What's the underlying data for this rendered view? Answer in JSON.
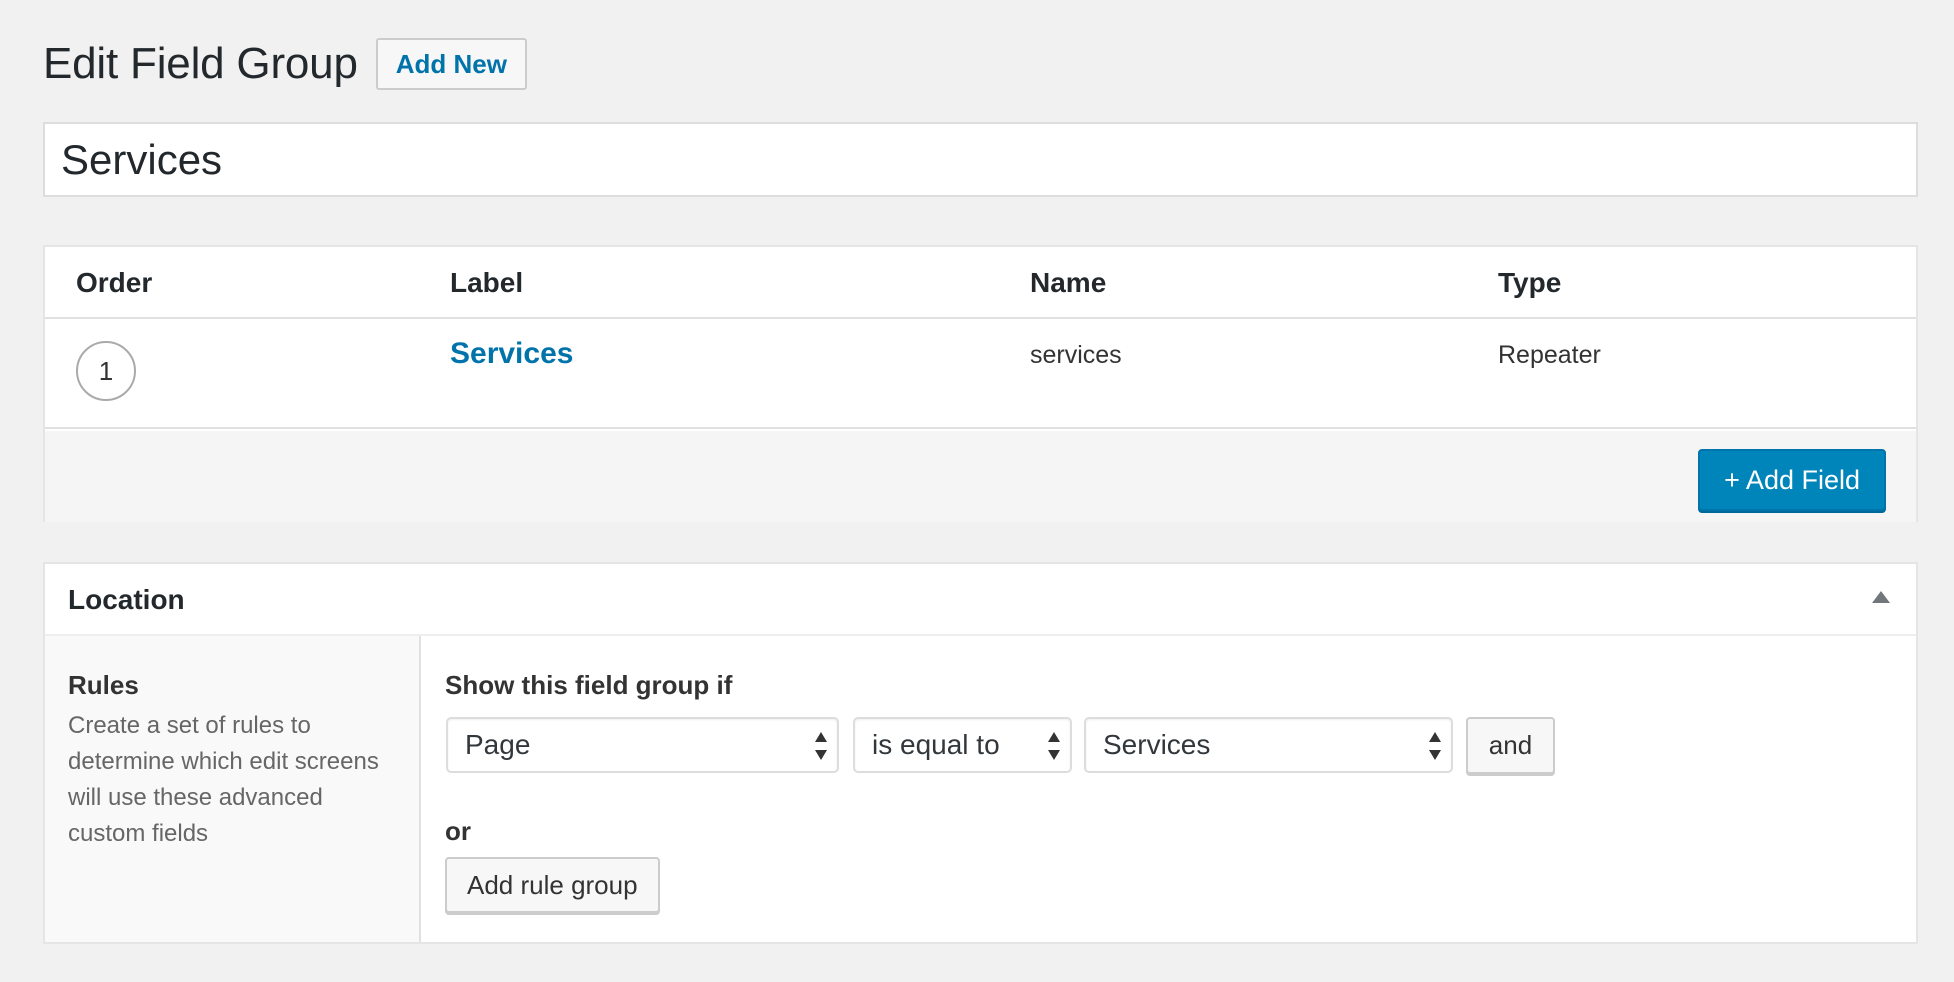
{
  "page": {
    "title": "Edit Field Group",
    "add_new_label": "Add New"
  },
  "field_group": {
    "title_value": "Services"
  },
  "fields_table": {
    "columns": [
      "Order",
      "Label",
      "Name",
      "Type"
    ],
    "rows": [
      {
        "order": "1",
        "label": "Services",
        "name": "services",
        "type": "Repeater"
      }
    ],
    "add_field_label": "+ Add Field"
  },
  "location": {
    "title": "Location",
    "rules_title": "Rules",
    "rules_description": "Create a set of rules to determine which edit screens will use these advanced custom fields",
    "show_if_label": "Show this field group if",
    "rule": {
      "param": "Page",
      "operator": "is equal to",
      "value": "Services"
    },
    "and_label": "and",
    "or_label": "or",
    "add_rule_group_label": "Add rule group"
  }
}
